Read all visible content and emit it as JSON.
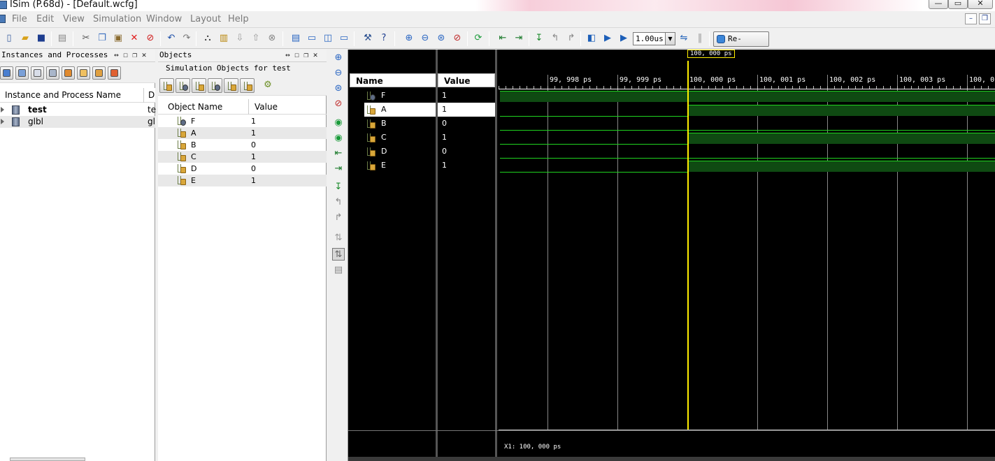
{
  "window": {
    "title": "ISim (P.68d) - [Default.wcfg]",
    "controls": {
      "minimize": "—",
      "maximize": "▭",
      "close": "✕"
    },
    "mdi_controls": {
      "minimize": "–",
      "restore": "❐"
    }
  },
  "menu": [
    "File",
    "Edit",
    "View",
    "Simulation",
    "Window",
    "Layout",
    "Help"
  ],
  "toolbar": {
    "sim_time": "1.00us",
    "relaunch_label": "Re-launch"
  },
  "instances_panel": {
    "title": "Instances and Processes",
    "controls": "↔ ☐ ❐ ✕",
    "columns": [
      "Instance and Process Name",
      "D"
    ],
    "rows": [
      {
        "name": "test",
        "desc": "te"
      },
      {
        "name": "glbl",
        "desc": "gl"
      }
    ]
  },
  "objects_panel": {
    "title": "Objects",
    "controls": "↔ ☐ ❐ ✕",
    "subtitle": "Simulation Objects for test",
    "columns": [
      "Object Name",
      "Value"
    ],
    "rows": [
      {
        "name": "F",
        "value": "1"
      },
      {
        "name": "A",
        "value": "1"
      },
      {
        "name": "B",
        "value": "0"
      },
      {
        "name": "C",
        "value": "1"
      },
      {
        "name": "D",
        "value": "0"
      },
      {
        "name": "E",
        "value": "1"
      }
    ]
  },
  "wave": {
    "name_header": "Name",
    "value_header": "Value",
    "signals": [
      {
        "name": "F",
        "value": "1",
        "before": "1",
        "after": "1"
      },
      {
        "name": "A",
        "value": "1",
        "before": "0",
        "after": "1"
      },
      {
        "name": "B",
        "value": "0",
        "before": "0",
        "after": "0"
      },
      {
        "name": "C",
        "value": "1",
        "before": "0",
        "after": "1"
      },
      {
        "name": "D",
        "value": "0",
        "before": "0",
        "after": "0"
      },
      {
        "name": "E",
        "value": "1",
        "before": "0",
        "after": "1"
      }
    ],
    "time_ticks": [
      "99, 998 ps",
      "99, 999 ps",
      "100, 000 ps",
      "100, 001 ps",
      "100, 002 ps",
      "100, 003 ps",
      "100, 0"
    ],
    "cursor_label": "100, 000 ps",
    "cursor_readout": "X1: 100, 000 ps"
  },
  "colors": {
    "wave_background": "#000000",
    "signal_green": "#1fd41f",
    "bus_fill": "#0f4a12",
    "cursor_yellow": "#ffee00"
  }
}
